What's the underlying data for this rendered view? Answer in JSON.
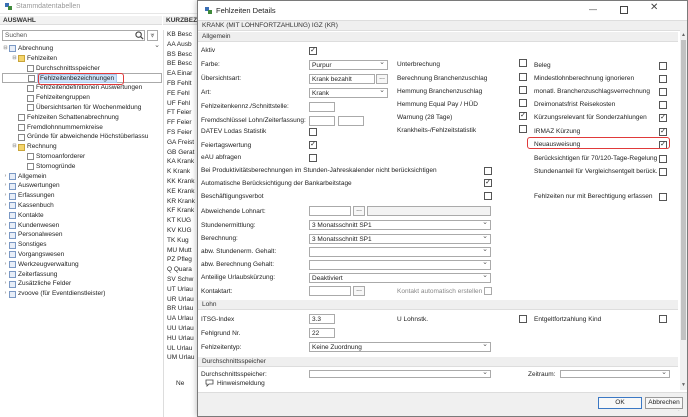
{
  "bg": {
    "title": "Stammdatentabellen",
    "panel_header": "AUSWAHL",
    "kz_header": "KURZBEZ",
    "search_placeholder": "Suchen",
    "filter_icon": "filter-icon",
    "tree": [
      {
        "label": "Abrechnung",
        "indent": 0,
        "toggle": "⊟",
        "type": "node"
      },
      {
        "label": "Fehlzeiten",
        "indent": 1,
        "toggle": "⊟",
        "type": "fold"
      },
      {
        "label": "Durchschnittsspeicher",
        "indent": 2,
        "toggle": "",
        "type": "doc"
      },
      {
        "label": "Fehlzeitenbezeichnungen",
        "indent": 2,
        "toggle": "",
        "type": "doc",
        "selected": true
      },
      {
        "label": "Fehlzeitendefinitionen Auswertungen",
        "indent": 2,
        "toggle": "",
        "type": "doc"
      },
      {
        "label": "Fehlzeitengruppen",
        "indent": 2,
        "toggle": "",
        "type": "doc"
      },
      {
        "label": "Übersichtsarten für Wochenmeldung",
        "indent": 2,
        "toggle": "",
        "type": "doc"
      },
      {
        "label": "Fehlzeiten Schattenabrechnung",
        "indent": 1,
        "toggle": "",
        "type": "doc"
      },
      {
        "label": "Fremdlohnnummernkreise",
        "indent": 1,
        "toggle": "",
        "type": "doc"
      },
      {
        "label": "Gründe für abweichende Höchstüberlassu",
        "indent": 1,
        "toggle": "",
        "type": "doc"
      },
      {
        "label": "Rechnung",
        "indent": 1,
        "toggle": "⊟",
        "type": "fold"
      },
      {
        "label": "Stornoanforderer",
        "indent": 2,
        "toggle": "",
        "type": "doc"
      },
      {
        "label": "Stornogründe",
        "indent": 2,
        "toggle": "",
        "type": "doc"
      },
      {
        "label": "Allgemein",
        "indent": 0,
        "toggle": "›",
        "type": "node"
      },
      {
        "label": "Auswertungen",
        "indent": 0,
        "toggle": "›",
        "type": "node"
      },
      {
        "label": "Erfassungen",
        "indent": 0,
        "toggle": "›",
        "type": "node"
      },
      {
        "label": "Kassenbuch",
        "indent": 0,
        "toggle": "›",
        "type": "node"
      },
      {
        "label": "Kontakte",
        "indent": 0,
        "toggle": "",
        "type": "node"
      },
      {
        "label": "Kundenwesen",
        "indent": 0,
        "toggle": "›",
        "type": "node"
      },
      {
        "label": "Personalwesen",
        "indent": 0,
        "toggle": "›",
        "type": "node"
      },
      {
        "label": "Sonstiges",
        "indent": 0,
        "toggle": "›",
        "type": "node"
      },
      {
        "label": "Vorgangswesen",
        "indent": 0,
        "toggle": "›",
        "type": "node"
      },
      {
        "label": "Werkzeugverwaltung",
        "indent": 0,
        "toggle": "›",
        "type": "node"
      },
      {
        "label": "Zeiterfassung",
        "indent": 0,
        "toggle": "›",
        "type": "node"
      },
      {
        "label": "Zusätzliche Felder",
        "indent": 0,
        "toggle": "›",
        "type": "node"
      },
      {
        "label": "zvoove (für Eventdienstleister)",
        "indent": 0,
        "toggle": "›",
        "type": "node"
      }
    ],
    "kz": [
      "KB Besc",
      "AA Ausb",
      "BS Besc",
      "BE Besc",
      "EA Einar",
      "FB Fehlt",
      "FE Fehl",
      "UF Fehl",
      "FT Feier",
      "FF Feier",
      "FS Feier",
      "GA Freist",
      "GB Gerat",
      "KA Krank",
      "K Krank",
      "KK Krank",
      "KE Krank",
      "KR Krank",
      "KF Krank",
      "KT KUG",
      "KV KUG",
      "TK Kug",
      "MU Mutt",
      "PZ Pfleg",
      "Q Quara",
      "SV Schw",
      "UT Urlau",
      "UR Urlau",
      "BR Urlau",
      "UA Urlau",
      "UU Urlau",
      "HU Urlau",
      "UL Urlau",
      "UM Urlau"
    ],
    "ne": "Ne"
  },
  "dlg": {
    "title": "Fehlzeiten Details",
    "subtitle": "KRANK (MIT LOHNFORTZAHLUNG) IGZ (KR)",
    "sec_allgemein": "Allgemein",
    "sec_lohn": "Lohn",
    "sec_durch": "Durchschnittsspeicher",
    "aktiv": "Aktiv",
    "farbe": "Farbe:",
    "farbe_val": "Purpur",
    "uebersichtsart": "Übersichtsart:",
    "uebersichtsart_val": "Krank bezahlt",
    "art": "Art:",
    "art_val": "Krank",
    "fehlzeitenkz": "Fehlzeitenkennz./Schnittstelle:",
    "fremdschluessel": "Fremdschlüssel Lohn/Zeiterfassung:",
    "datev": "DATEV Lodas Statistik",
    "feiertag": "Feiertagswertung",
    "eau": "eAU abfragen",
    "mid": [
      "Unterbrechung",
      "Berechnung Branchenzuschlag",
      "Hemmung Branchenzuschlag",
      "Hemmung Equal Pay / HÜD",
      "Warnung (28 Tage)",
      "Krankheits-/Fehlzeitstatistik"
    ],
    "right": [
      "Beleg",
      "Mindestlohnberechnung ignorieren",
      "monatl. Branchenzuschlagsverrechnung",
      "Dreimonatsfrist Reisekosten",
      "Kürzungsrelevant für Sonderzahlungen",
      "IRMAZ Kürzung",
      "Neuausweisung",
      "Berücksichtigen für 70/120-Tage-Regelung",
      "Stundenanteil für Vergleichsentgelt berück.",
      "",
      "Fehlzeiten nur mit Berechtigung erfassen"
    ],
    "bei_produktiv": "Bei Produktivitätsberechnungen im Stunden-Jahreskalender nicht berücksichtigen",
    "automatische": "Automatische Berücksichtigung der Bankarbeitstage",
    "beschaeftigung": "Beschäftigungsverbot",
    "abweichende_lohnart": "Abweichende Lohnart:",
    "stundenermittlung": "Stundenermittlung:",
    "stundenermittlung_val": "3 Monatsschnitt SP1",
    "berechnung": "Berechnung:",
    "berechnung_val": "3 Monatsschnitt SP1",
    "abw_stunden": "abw. Stundenerm. Gehalt:",
    "abw_berech": "abw. Berechnung Gehalt:",
    "anteilige": "Anteilige Urlaubskürzung:",
    "anteilige_val": "Deaktiviert",
    "kontaktart": "Kontaktart:",
    "kontakt_auto": "Kontakt automatisch erstellen",
    "itsg": "ITSG-Index",
    "itsg_val": "3.3",
    "fehlgrund": "Fehlgrund Nr.",
    "fehlgrund_val": "22",
    "fehlzeitentyp": "Fehlzeitentyp:",
    "fehlzeitentyp_val": "Keine Zuordnung",
    "lohnstk": "U Lohnstk.",
    "entgelt": "Entgeltfortzahlung Kind",
    "durch_label": "Durchschnittsspeicher:",
    "zeitraum": "Zeitraum:",
    "hinweis": "Hinweismeldung",
    "ok": "OK",
    "abbrechen": "Abbrechen"
  }
}
